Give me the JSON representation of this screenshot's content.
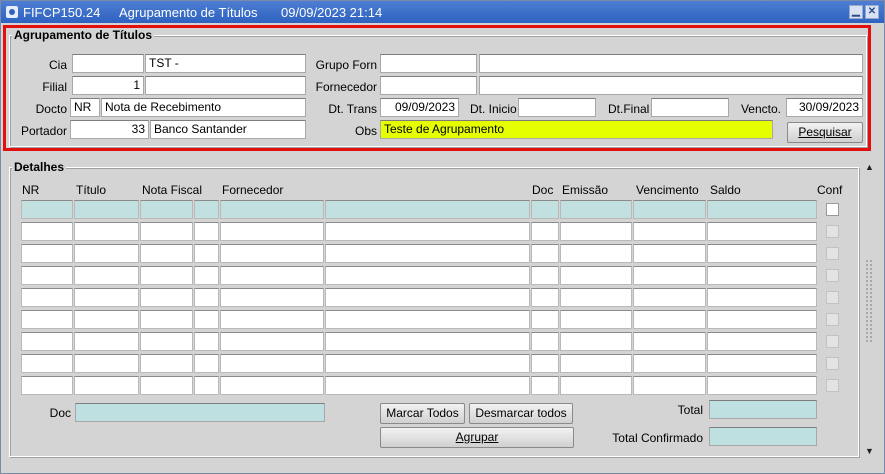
{
  "window": {
    "form_code": "FIFCP150.24",
    "title": "Agrupamento de Títulos",
    "datetime": "09/09/2023 21:14",
    "minimize_glyph": "▁",
    "close_glyph": "✕"
  },
  "header": {
    "section_title": "Agrupamento de Títulos",
    "cia": {
      "label": "Cia",
      "code": "",
      "name": "TST -"
    },
    "filial": {
      "label": "Filial",
      "code": "1",
      "name": ""
    },
    "docto": {
      "label": "Docto",
      "code": "NR",
      "description": "Nota de Recebimento"
    },
    "portador": {
      "label": "Portador",
      "code": "33",
      "name": "Banco Santander"
    },
    "grupo_forn": {
      "label": "Grupo Forn",
      "code": "",
      "name": ""
    },
    "fornecedor": {
      "label": "Fornecedor",
      "code": "",
      "name": ""
    },
    "dt_trans": {
      "label": "Dt. Trans",
      "value": "09/09/2023"
    },
    "dt_inicio": {
      "label": "Dt. Inicio",
      "value": ""
    },
    "dt_final": {
      "label": "Dt.Final",
      "value": ""
    },
    "vencto": {
      "label": "Vencto.",
      "value": "30/09/2023"
    },
    "obs": {
      "label": "Obs",
      "value": "Teste de Agrupamento"
    },
    "pesquisar_label": "Pesquisar"
  },
  "details": {
    "section_title": "Detalhes",
    "columns": [
      "NR",
      "Título",
      "Nota Fiscal",
      "Fornecedor",
      "Doc",
      "Emissão",
      "Vencimento",
      "Saldo",
      "Conf"
    ],
    "row_count": 9,
    "doc_label": "Doc",
    "doc_value": "",
    "marcar_todos": "Marcar Todos",
    "desmarcar_todos": "Desmarcar todos",
    "agrupar": "Agrupar",
    "total_label": "Total",
    "total_value": "",
    "total_confirmado_label": "Total Confirmado",
    "total_confirmado_value": ""
  },
  "colors": {
    "titlebar": "#2f62c0",
    "highlight_border": "#e30f0f",
    "obs_background": "#e6ff00",
    "readonly_teal": "#bfe0e0"
  }
}
